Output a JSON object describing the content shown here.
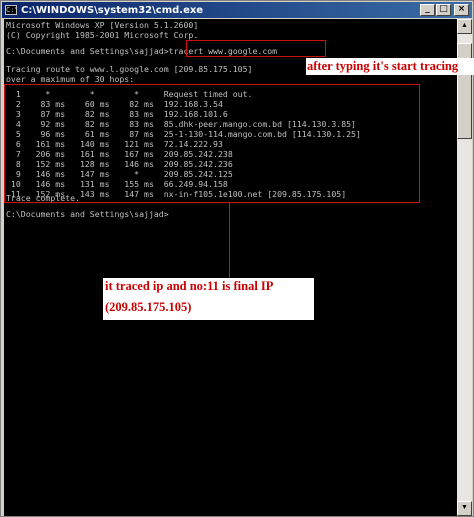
{
  "window": {
    "title": "C:\\WINDOWS\\system32\\cmd.exe",
    "icon": "cmd-icon",
    "minimize_glyph": "_",
    "maximize_glyph": "□",
    "close_glyph": "×"
  },
  "console": {
    "lines": [
      "Microsoft Windows XP [Version 5.1.2600]",
      "(C) Copyright 1985-2001 Microsoft Corp.",
      "",
      "C:\\Documents and Settings\\sajjad>tracert www.google.com",
      "",
      "Tracing route to www.l.google.com [209.85.175.105]",
      "over a maximum of 30 hops:",
      "",
      "  1     *        *        *     Request timed out.",
      "  2    83 ms    60 ms    82 ms  192.168.3.54",
      "  3    87 ms    82 ms    83 ms  192.168.101.6",
      "  4    92 ms    82 ms    83 ms  85.dhk-peer.mango.com.bd [114.130.3.85]",
      "  5    96 ms    61 ms    87 ms  25-1-130-114.mango.com.bd [114.130.1.25]",
      "  6   161 ms   140 ms   121 ms  72.14.222.93",
      "  7   206 ms   161 ms   167 ms  209.85.242.238",
      "  8   152 ms   128 ms   146 ms  209.85.242.236",
      "  9   146 ms   147 ms     *     209.85.242.125",
      " 10   146 ms   131 ms   155 ms  66.249.94.158",
      " 11   152 ms   143 ms   147 ms  nx-in-f105.1e100.net [209.85.175.105]",
      "",
      "Trace complete.",
      "",
      "C:\\Documents and Settings\\sajjad>"
    ]
  },
  "annotations": {
    "typing_note": "after typing it's start tracing",
    "result_note_line1": "it traced ip and no:11 is final IP",
    "result_note_line2": "(209.85.175.105)",
    "color": "#cc1111"
  },
  "colors": {
    "console_bg": "#000000",
    "console_text": "#c0c0c0",
    "titlebar_start": "#0a246a",
    "titlebar_end": "#3a6ea5"
  }
}
